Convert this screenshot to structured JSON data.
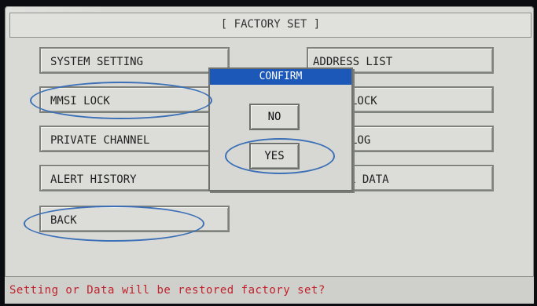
{
  "header": {
    "title": "[ FACTORY SET ]"
  },
  "menu": {
    "left": [
      {
        "label": "SYSTEM SETTING"
      },
      {
        "label": "MMSI LOCK"
      },
      {
        "label": "PRIVATE CHANNEL"
      },
      {
        "label": "ALERT HISTORY"
      },
      {
        "label": "BACK"
      }
    ],
    "right_visible": [
      {
        "label": "ADDRESS LIST"
      },
      {
        "label": "LOCK"
      },
      {
        "label": "LOG"
      },
      {
        "label": "L DATA"
      }
    ]
  },
  "dialog": {
    "title": "CONFIRM",
    "no_label": "NO",
    "yes_label": "YES"
  },
  "status": {
    "message": "Setting or Data will be restored factory set?"
  },
  "colors": {
    "dialog_title_bg": "#1c58b8",
    "status_text": "#c0212a",
    "annotation": "#3b6fb6"
  }
}
